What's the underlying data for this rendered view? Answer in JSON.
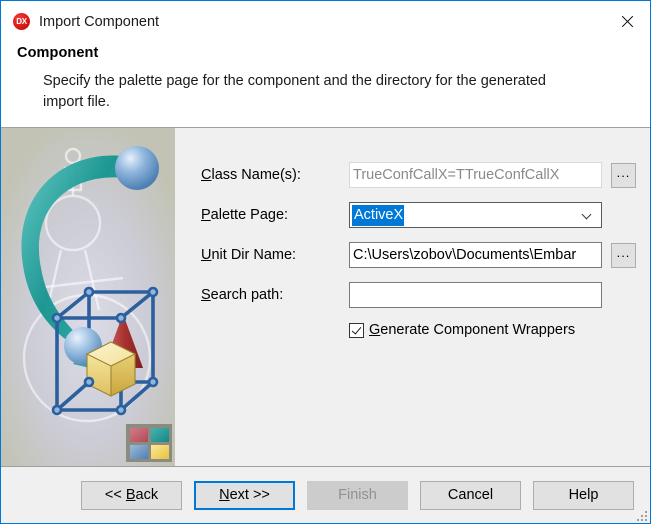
{
  "window": {
    "title": "Import Component",
    "app_icon": "dx-logo-icon",
    "app_icon_text": "DX",
    "close_icon": "close-icon",
    "accent_color": "#0078d7"
  },
  "header": {
    "title": "Component",
    "description": "Specify the palette page for the component and the directory for the generated import file."
  },
  "illustration": {
    "name": "component-wizard-illustration",
    "background_color": "#c2c3b4",
    "arrow_color": "#1d9c9c",
    "cube_color": "#2c5f9e",
    "logo_colors": [
      "#c0566b",
      "#1f9a9a",
      "#5b8fc0",
      "#f2d35c"
    ]
  },
  "form": {
    "class_names": {
      "label": "Class Name(s):",
      "accel": "C",
      "value": "TrueConfCallX=TTrueConfCallX",
      "readonly": true,
      "browse_label": "..."
    },
    "palette_page": {
      "label": "Palette Page:",
      "accel": "P",
      "value": "ActiveX",
      "selected": true,
      "arrow_icon": "chevron-down-icon"
    },
    "unit_dir_name": {
      "label": "Unit Dir Name:",
      "accel": "U",
      "value": "C:\\Users\\zobov\\Documents\\Embar",
      "browse_label": "..."
    },
    "search_path": {
      "label": "Search path:",
      "accel": "S",
      "value": "",
      "placeholder": ""
    },
    "generate_wrappers": {
      "label": "Generate Component Wrappers",
      "accel": "G",
      "checked": true
    }
  },
  "footer": {
    "buttons": [
      {
        "name": "back-button",
        "label": "<< Back",
        "state": "enabled"
      },
      {
        "name": "next-button",
        "label": "Next >>",
        "state": "default"
      },
      {
        "name": "finish-button",
        "label": "Finish",
        "state": "disabled"
      },
      {
        "name": "cancel-button",
        "label": "Cancel",
        "state": "enabled"
      },
      {
        "name": "help-button",
        "label": "Help",
        "state": "enabled"
      }
    ]
  }
}
